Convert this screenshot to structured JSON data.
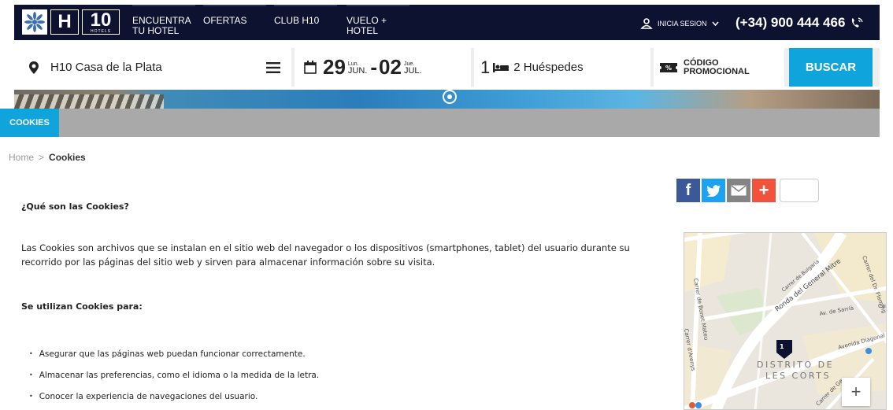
{
  "nav": {
    "logo_text": "H 10",
    "logo_sub": "HOTELS",
    "links": [
      {
        "label": "ENCUENTRA TU HOTEL"
      },
      {
        "label": "OFERTAS"
      },
      {
        "label": "CLUB H10"
      },
      {
        "label": "VUELO + HOTEL"
      }
    ],
    "login_label": "INICIA SESION",
    "phone": "(+34) 900 444 466"
  },
  "search": {
    "hotel": "H10 Casa de la Plata",
    "date_from_day": "29",
    "date_from_weekday": "Lun.",
    "date_from_month": "JUN.",
    "date_separator": "-",
    "date_to_day": "02",
    "date_to_weekday": "Jue.",
    "date_to_month": "JUL.",
    "rooms": "1",
    "guests": "2 Huéspedes",
    "promo_line1": "CÓDIGO",
    "promo_line2": "PROMOCIONAL",
    "search_button": "BUSCAR"
  },
  "tabs": {
    "active": "COOKIES"
  },
  "breadcrumb": {
    "home": "Home",
    "sep": ">",
    "current": "Cookies"
  },
  "article": {
    "heading1": "¿Qué son las Cookies?",
    "para1_line1": "Las Cookies son archivos que se instalan en el sitio web del navegador o los dispositivos (smartphones, tablet) del usuario durante su",
    "para1_line2": "recorrido por las páginas del sitio web y sirven para almacenar información sobre su visita.",
    "heading2": "Se utilizan Cookies para:",
    "bullets": [
      "Asegurar que las páginas web puedan funcionar correctamente.",
      "Almacenar las preferencias, como el idioma o la medida de la letra.",
      "Conocer la experiencia de navegaciones del usuario."
    ]
  },
  "share": {
    "facebook": "f",
    "twitter": "t",
    "plus": "+"
  },
  "map": {
    "labels": [
      "Carrer de Bonet Mateu",
      "Carrer de Bulgaria",
      "Ronda del General Mitre",
      "Carrer del Dr. Fleming",
      "Av. de Sarrià",
      "Carrer d'Arenys",
      "Avenida Diagonal",
      "DISTRITO DE",
      "LES CORTS",
      "Carrer de Ge",
      "Car"
    ],
    "marker": "1",
    "zoom_in": "+"
  }
}
